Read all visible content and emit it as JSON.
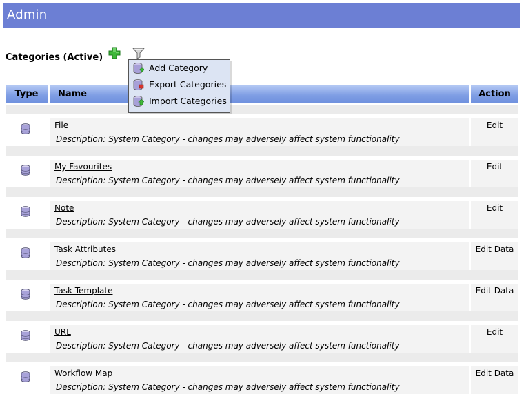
{
  "header": {
    "title": "Admin"
  },
  "section": {
    "title": "Categories (Active)"
  },
  "toolbar": {
    "add_icon": "add-icon",
    "filter_icon": "filter-icon"
  },
  "table": {
    "columns": {
      "type": "Type",
      "name": "Name",
      "action": "Action"
    },
    "rows": [
      {
        "name": "File",
        "description": "Description: System Category - changes may adversely affect system functionality",
        "action": "Edit"
      },
      {
        "name": "My Favourites",
        "description": "Description: System Category - changes may adversely affect system functionality",
        "action": "Edit"
      },
      {
        "name": "Note",
        "description": "Description: System Category - changes may adversely affect system functionality",
        "action": "Edit"
      },
      {
        "name": "Task Attributes",
        "description": "Description: System Category - changes may adversely affect system functionality",
        "action": "Edit Data"
      },
      {
        "name": "Task Template",
        "description": "Description: System Category - changes may adversely affect system functionality",
        "action": "Edit Data"
      },
      {
        "name": "URL",
        "description": "Description: System Category - changes may adversely affect system functionality",
        "action": "Edit"
      },
      {
        "name": "Workflow Map",
        "description": "Description: System Category - changes may adversely affect system functionality",
        "action": "Edit Data"
      }
    ]
  },
  "menu": {
    "items": [
      {
        "label": "Add Category",
        "icon": "add-category-icon"
      },
      {
        "label": "Export Categories",
        "icon": "export-categories-icon"
      },
      {
        "label": "Import Categories",
        "icon": "import-categories-icon"
      }
    ]
  },
  "colors": {
    "titlebar": "#6c7fd4",
    "header_gradient": "#7f9ee4",
    "row_band": "#f3f3f3"
  }
}
